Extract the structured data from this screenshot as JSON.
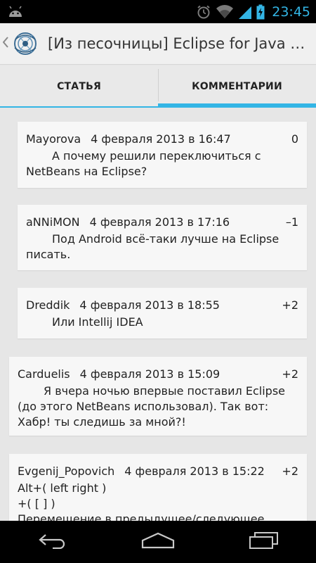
{
  "status_bar": {
    "time": "23:45",
    "icons": [
      "android-icon",
      "alarm-icon",
      "wifi-icon",
      "signal-icon",
      "battery-charging-icon"
    ],
    "accent_color": "#33b5e5"
  },
  "action_bar": {
    "title": "[Из песочницы] Eclipse for Java Developers",
    "icons": [
      "up-caret-icon",
      "app-logo-icon"
    ]
  },
  "tabs": [
    {
      "label": "СТАТЬЯ",
      "selected": false
    },
    {
      "label": "КОММЕНТАРИИ",
      "selected": true
    }
  ],
  "comments": [
    {
      "author": "Mayorova",
      "date": "4 февраля 2013 в 16:47",
      "score": "0",
      "text": "А почему решили переключиться с NetBeans на Eclipse?"
    },
    {
      "author": "aNNiMON",
      "date": "4 февраля 2013 в 17:16",
      "score": "–1",
      "text": "Под Android всё-таки лучше на Eclipse писать."
    },
    {
      "author": "Dreddik",
      "date": "4 февраля 2013 в 18:55",
      "score": "+2",
      "text": "Или Intellij IDEA"
    },
    {
      "author": "Carduelis",
      "date": "4 февраля 2013 в 15:09",
      "score": "+2",
      "text": "Я вчера ночью впервые поставил Eclipse (до этого NetBeans использовал). Так вот: Хабр! ты следишь за мной?!"
    },
    {
      "author": "Evgenij_Popovich",
      "date": "4 февраля 2013 в 15:22",
      "score": "+2",
      "text": "Alt+( left right )\n +( [ ] )\nПеремещение в предыдущее/следующее"
    }
  ],
  "nav_bar": {
    "icons": [
      "back-icon",
      "home-icon",
      "recent-apps-icon"
    ]
  }
}
